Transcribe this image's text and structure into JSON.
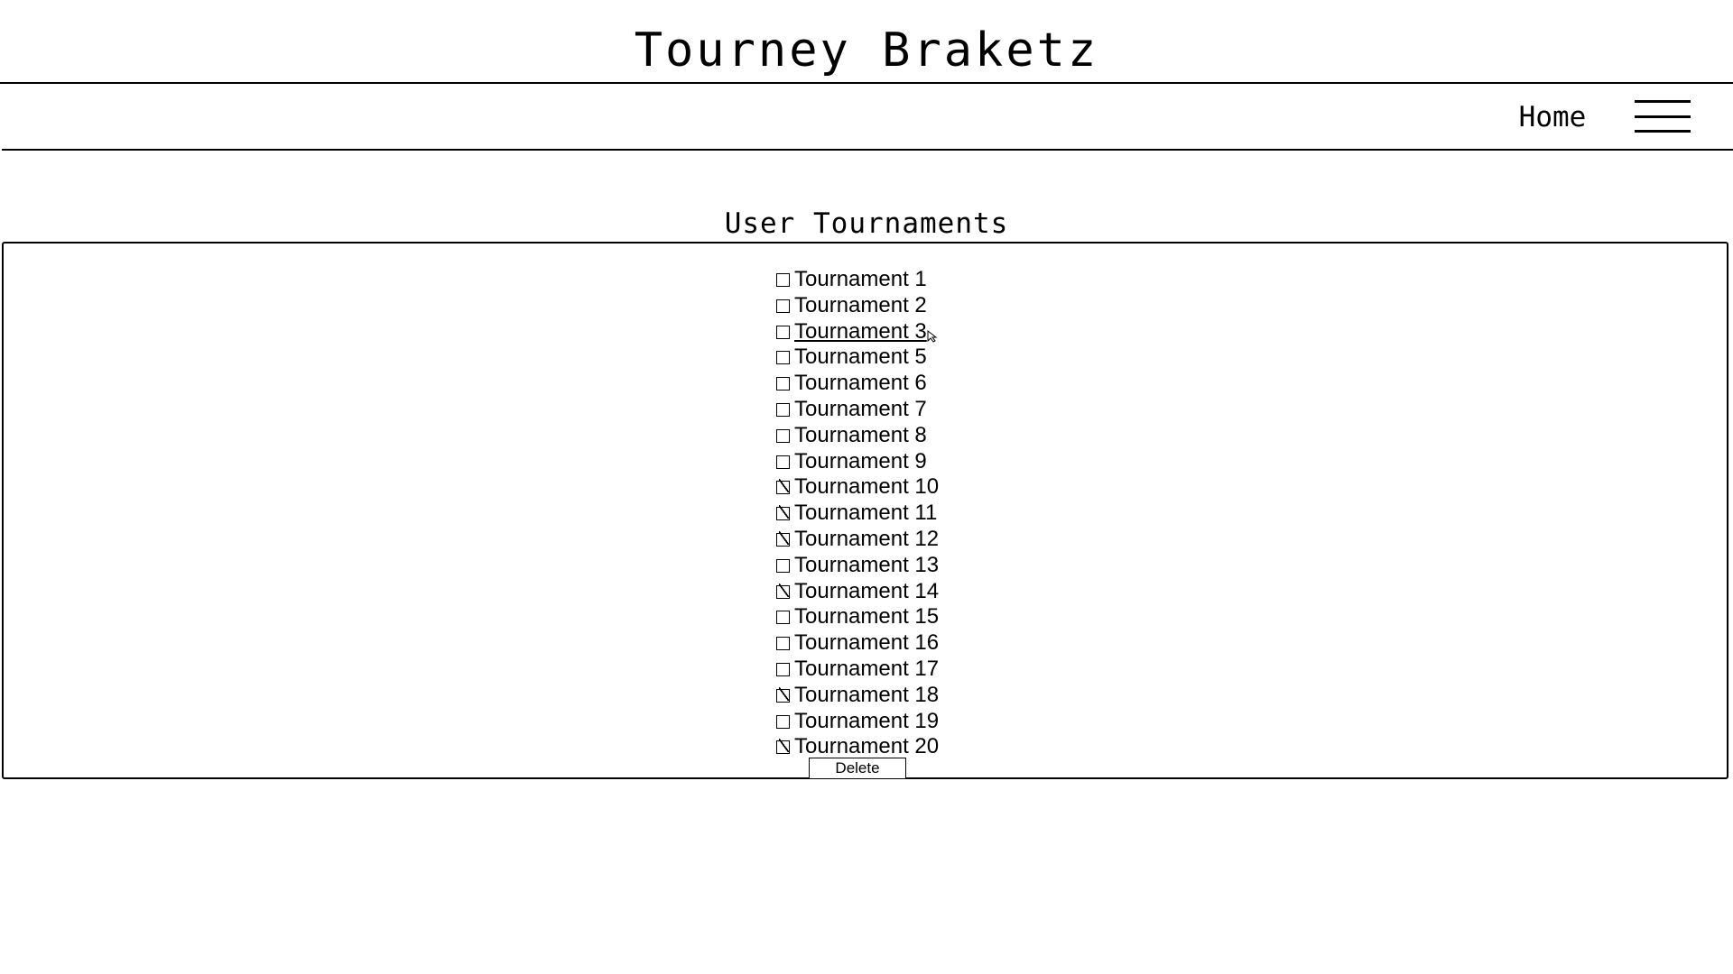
{
  "header": {
    "site_title": "Tourney Braketz",
    "nav": {
      "home_label": "Home",
      "menu_icon": "hamburger-menu-icon"
    }
  },
  "main": {
    "section_title": "User Tournaments",
    "tournaments": [
      {
        "label": "Tournament 1",
        "checked": false
      },
      {
        "label": "Tournament 2",
        "checked": false
      },
      {
        "label": "Tournament 3",
        "checked": false,
        "hovered": true
      },
      {
        "label": "Tournament 5",
        "checked": false
      },
      {
        "label": "Tournament 6",
        "checked": false
      },
      {
        "label": "Tournament 7",
        "checked": false
      },
      {
        "label": "Tournament 8",
        "checked": false
      },
      {
        "label": "Tournament 9",
        "checked": false
      },
      {
        "label": "Tournament 10",
        "checked": true
      },
      {
        "label": "Tournament 11",
        "checked": true
      },
      {
        "label": "Tournament 12",
        "checked": true
      },
      {
        "label": "Tournament 13",
        "checked": false
      },
      {
        "label": "Tournament 14",
        "checked": true
      },
      {
        "label": "Tournament 15",
        "checked": false
      },
      {
        "label": "Tournament 16",
        "checked": false
      },
      {
        "label": "Tournament 17",
        "checked": false
      },
      {
        "label": "Tournament 18",
        "checked": true
      },
      {
        "label": "Tournament 19",
        "checked": false
      },
      {
        "label": "Tournament 20",
        "checked": true
      }
    ],
    "delete_label": "Delete"
  }
}
